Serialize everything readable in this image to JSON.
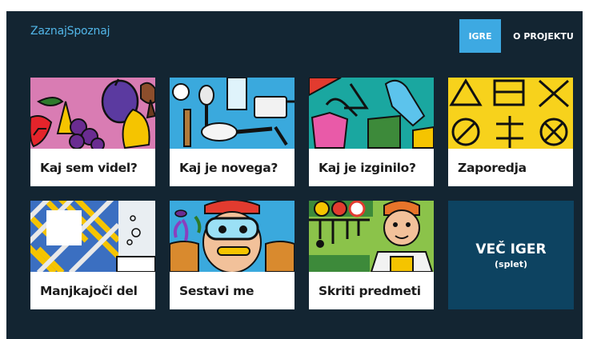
{
  "header": {
    "brand": "ZaznajSpoznaj",
    "nav": {
      "games": "IGRE",
      "about": "O PROJEKTU"
    }
  },
  "games": [
    {
      "label": "Kaj sem videl?"
    },
    {
      "label": "Kaj je novega?"
    },
    {
      "label": "Kaj je izginilo?"
    },
    {
      "label": "Zaporedja"
    },
    {
      "label": "Manjkajoči del"
    },
    {
      "label": "Sestavi me"
    },
    {
      "label": "Skriti predmeti"
    }
  ],
  "more": {
    "title": "VEČ IGER",
    "subtitle": "(splet)"
  },
  "colors": {
    "accent": "#3da9e2",
    "background": "#132532",
    "more_tile": "#0d4361"
  }
}
